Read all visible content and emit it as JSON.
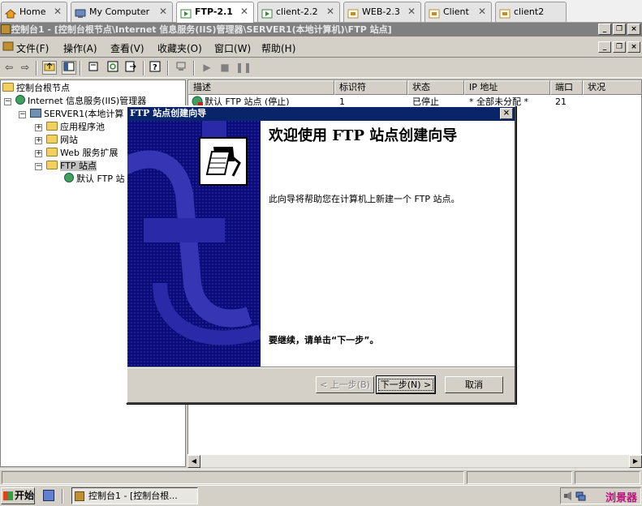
{
  "vm_tabs": [
    {
      "label": "Home",
      "active": false
    },
    {
      "label": "My Computer",
      "active": false
    },
    {
      "label": "FTP-2.1",
      "active": true
    },
    {
      "label": "client-2.2",
      "active": false
    },
    {
      "label": "WEB-2.3",
      "active": false
    },
    {
      "label": "Client",
      "active": false
    },
    {
      "label": "client2",
      "active": false
    }
  ],
  "window": {
    "title": "控制台1 - [控制台根节点\\Internet 信息服务(IIS)管理器\\SERVER1(本地计算机)\\FTP 站点]",
    "caption_min": "_",
    "caption_restore": "❐",
    "caption_close": "×"
  },
  "menu": [
    "文件(F)",
    "操作(A)",
    "查看(V)",
    "收藏夹(O)",
    "窗口(W)",
    "帮助(H)"
  ],
  "tree": {
    "root": "控制台根节点",
    "iis": "Internet 信息服务(IIS)管理器",
    "server": "SERVER1(本地计算",
    "app_pools": "应用程序池",
    "websites": "网站",
    "web_ext": "Web 服务扩展",
    "ftp_sites": "FTP 站点",
    "default_ftp": "默认 FTP 站"
  },
  "list": {
    "columns": [
      "描述",
      "标识符",
      "状态",
      "IP 地址",
      "端口",
      "状况"
    ],
    "rows": [
      {
        "desc": "默认 FTP 站点 (停止)",
        "id": "1",
        "state": "已停止",
        "ip": "* 全部未分配 *",
        "port": "21",
        "status": ""
      }
    ]
  },
  "wizard": {
    "title": "FTP 站点创建向导",
    "heading": "欢迎使用 FTP 站点创建向导",
    "description": "此向导将帮助您在计算机上新建一个 FTP 站点。",
    "continue_text": "要继续，请单击“下一步”。",
    "back_label": "< 上一步(B)",
    "next_label": "下一步(N) >",
    "cancel_label": "取消",
    "close_glyph": "×"
  },
  "taskbar": {
    "start_label": "开始",
    "task_label": "控制台1 - [控制台根...",
    "tray_text": "浏景器"
  }
}
